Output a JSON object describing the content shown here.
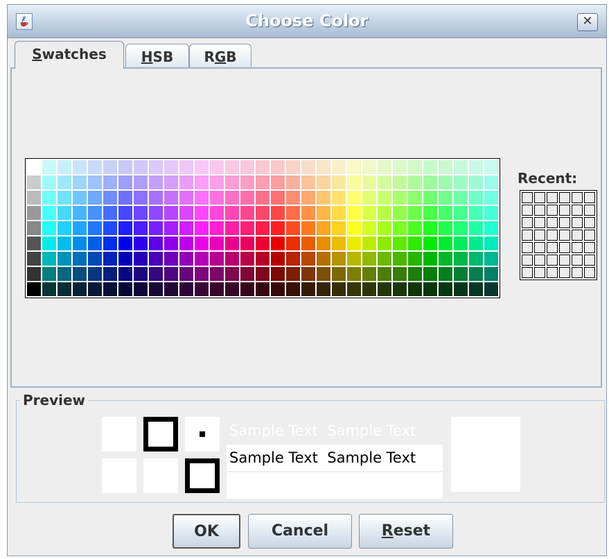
{
  "window": {
    "title": "Choose Color",
    "close_glyph": "✕"
  },
  "tabs": [
    {
      "label_mnemonic": "S",
      "label_rest": "watches",
      "active": true
    },
    {
      "label_mnemonic": "H",
      "label_rest": "SB",
      "active": false
    },
    {
      "label_pre": "R",
      "label_mnemonic": "G",
      "label_rest": "B",
      "active": false
    }
  ],
  "swatches": {
    "left_column_grays": [
      "#ffffff",
      "#cccccc",
      "#bbbbbb",
      "#999999",
      "#888888",
      "#555555",
      "#444444",
      "#333333",
      "#000000"
    ]
  },
  "recent": {
    "label": "Recent:",
    "cell_color": "#ececec"
  },
  "preview": {
    "label": "Preview",
    "sample_text": "Sample Text",
    "text_colors": {
      "light": "#ffffff",
      "dark": "#000000"
    }
  },
  "buttons": {
    "ok": "OK",
    "cancel": "Cancel",
    "reset_mnemonic": "R",
    "reset_rest": "eset"
  }
}
